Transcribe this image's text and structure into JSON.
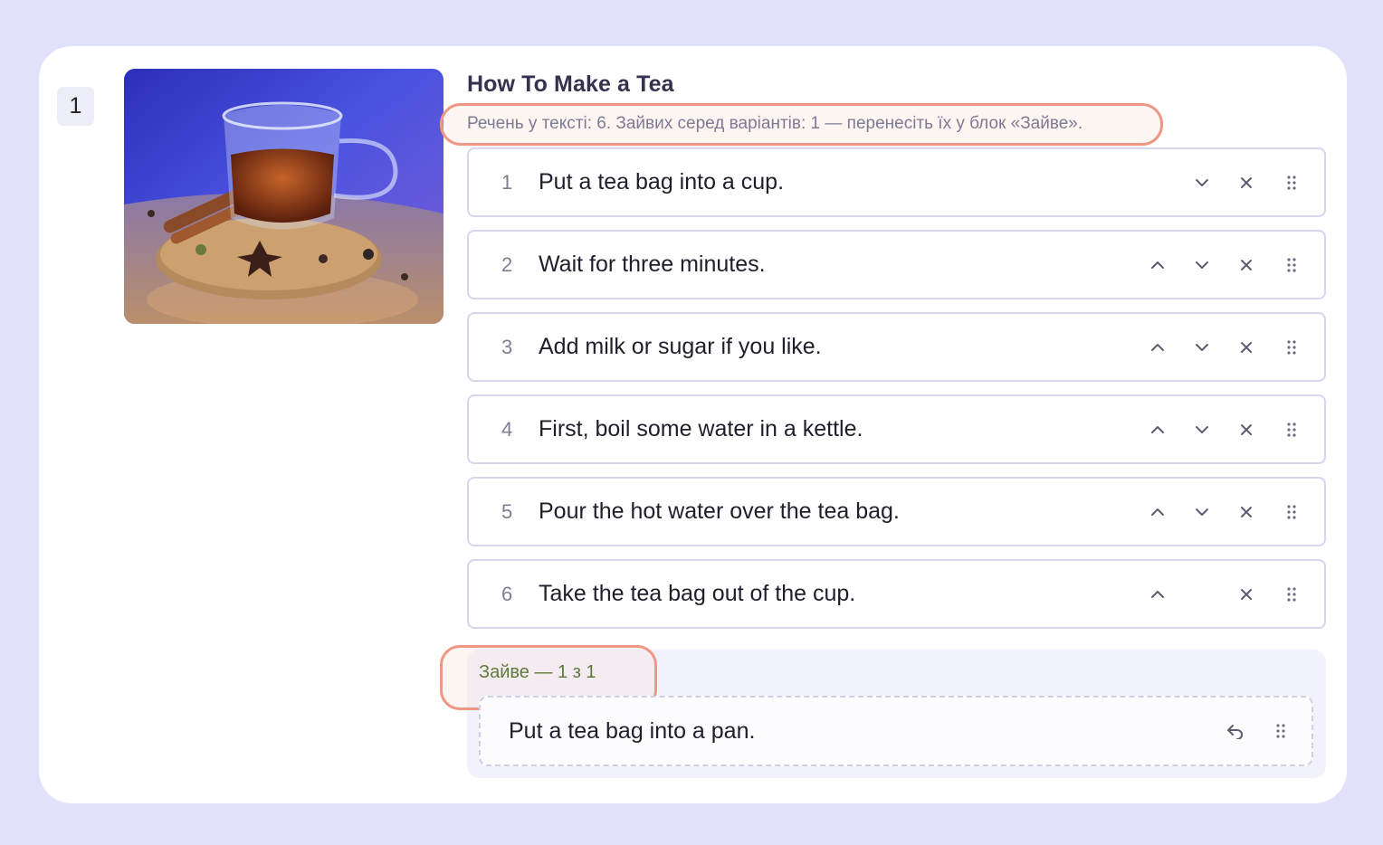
{
  "question": {
    "number": "1",
    "title": "How To Make a Tea",
    "hint": "Речень у тексті: 6. Зайвих серед варіантів: 1 — перенесіть їх у блок «Зайве».",
    "image_alt": "Cup of tea on a cork coaster with cinnamon and star anise"
  },
  "sentences": [
    {
      "index": "1",
      "text": "Put a tea bag into a cup.",
      "controls": [
        "chevron-down-icon",
        "close-icon",
        "drag-handle-icon"
      ]
    },
    {
      "index": "2",
      "text": "Wait for three minutes.",
      "controls": [
        "chevron-up-icon",
        "chevron-down-icon",
        "close-icon",
        "drag-handle-icon"
      ]
    },
    {
      "index": "3",
      "text": "Add milk or sugar if you like.",
      "controls": [
        "chevron-up-icon",
        "chevron-down-icon",
        "close-icon",
        "drag-handle-icon"
      ]
    },
    {
      "index": "4",
      "text": "First, boil some water in a kettle.",
      "controls": [
        "chevron-up-icon",
        "chevron-down-icon",
        "close-icon",
        "drag-handle-icon"
      ]
    },
    {
      "index": "5",
      "text": "Pour the hot water over the tea bag.",
      "controls": [
        "chevron-up-icon",
        "chevron-down-icon",
        "close-icon",
        "drag-handle-icon"
      ]
    },
    {
      "index": "6",
      "text": "Take the tea bag out of the cup.",
      "controls": [
        "chevron-up-icon",
        "close-icon",
        "drag-handle-icon"
      ]
    }
  ],
  "extra": {
    "title": "Зайве — 1 з 1",
    "items": [
      {
        "text": "Put a tea bag into a pan.",
        "controls": [
          "undo-icon",
          "drag-handle-icon"
        ]
      }
    ]
  },
  "colors": {
    "page_background": "#e1e1fb",
    "highlight_outline": "#ed9784",
    "extra_title": "#5e7a3b",
    "item_border": "#d6d6ee"
  }
}
